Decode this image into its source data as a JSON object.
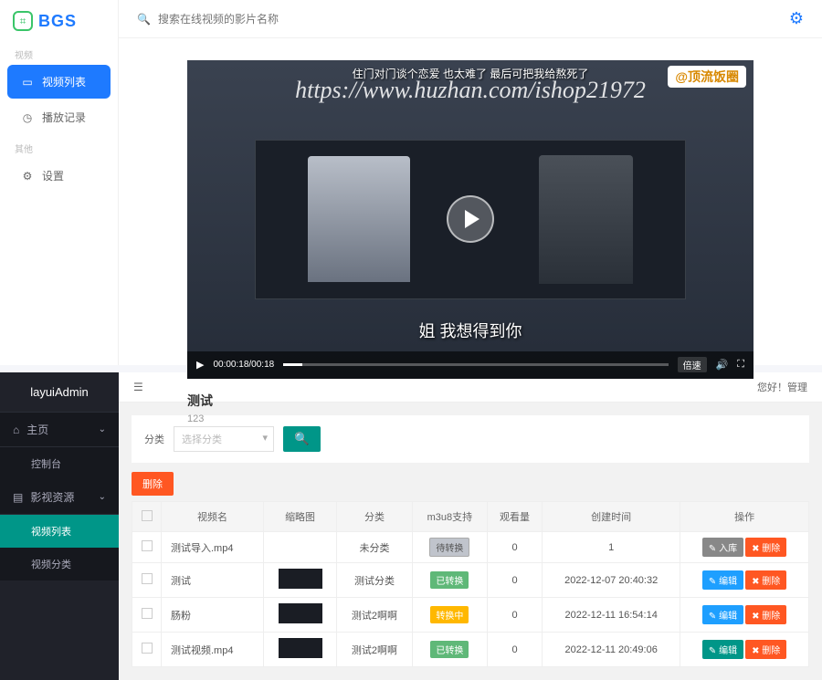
{
  "top": {
    "logo": "BGS",
    "search_placeholder": "搜索在线视频的影片名称",
    "nav_groups": [
      "视频",
      "其他"
    ],
    "nav": [
      {
        "label": "视频列表",
        "active": true
      },
      {
        "label": "播放记录",
        "active": false
      },
      {
        "label": "设置",
        "active": false
      }
    ],
    "video": {
      "badge": "@顶流饭圈",
      "sub_top": "住门对门谈个恋爱 也太难了 最后可把我给熬死了",
      "sub_bottom": "姐 我想得到你",
      "watermark": "https://www.huzhan.com/ishop21972",
      "time": "00:00:18/00:18",
      "speed": "倍速",
      "title": "测试",
      "desc": "123"
    }
  },
  "bottom": {
    "logo": "layuiAdmin",
    "greet": "您好！管理",
    "nav": [
      {
        "label": "主页",
        "children": [
          {
            "label": "控制台",
            "active": false
          }
        ]
      },
      {
        "label": "影视资源",
        "children": [
          {
            "label": "视频列表",
            "active": true
          },
          {
            "label": "视频分类",
            "active": false
          }
        ]
      }
    ],
    "filter": {
      "label": "分类",
      "placeholder": "选择分类"
    },
    "del_btn": "删除",
    "columns": [
      "",
      "视频名",
      "缩略图",
      "分类",
      "m3u8支持",
      "观看量",
      "创建时间",
      "操作"
    ],
    "rows": [
      {
        "name": "测试导入.mp4",
        "thumb": false,
        "cat": "未分类",
        "m3u8": {
          "text": "待转换",
          "cls": "tag-gray"
        },
        "views": "0",
        "ctime": "1",
        "ops": [
          {
            "text": "✎ 入库",
            "cls": "op-gray"
          },
          {
            "text": "✖ 删除",
            "cls": "op-red"
          }
        ]
      },
      {
        "name": "测试",
        "thumb": true,
        "cat": "测试分类",
        "m3u8": {
          "text": "已转换",
          "cls": "tag-green"
        },
        "views": "0",
        "ctime": "2022-12-07 20:40:32",
        "ops": [
          {
            "text": "✎ 编辑",
            "cls": "op-blue"
          },
          {
            "text": "✖ 删除",
            "cls": "op-red"
          }
        ]
      },
      {
        "name": "肠粉",
        "thumb": true,
        "cat": "测试2啊啊",
        "m3u8": {
          "text": "转换中",
          "cls": "tag-orange"
        },
        "views": "0",
        "ctime": "2022-12-11 16:54:14",
        "ops": [
          {
            "text": "✎ 编辑",
            "cls": "op-blue"
          },
          {
            "text": "✖ 删除",
            "cls": "op-red"
          }
        ]
      },
      {
        "name": "测试视频.mp4",
        "thumb": true,
        "cat": "测试2啊啊",
        "m3u8": {
          "text": "已转换",
          "cls": "tag-green"
        },
        "views": "0",
        "ctime": "2022-12-11 20:49:06",
        "ops": [
          {
            "text": "✎ 编辑",
            "cls": "op-teal"
          },
          {
            "text": "✖ 删除",
            "cls": "op-red"
          }
        ]
      }
    ]
  }
}
